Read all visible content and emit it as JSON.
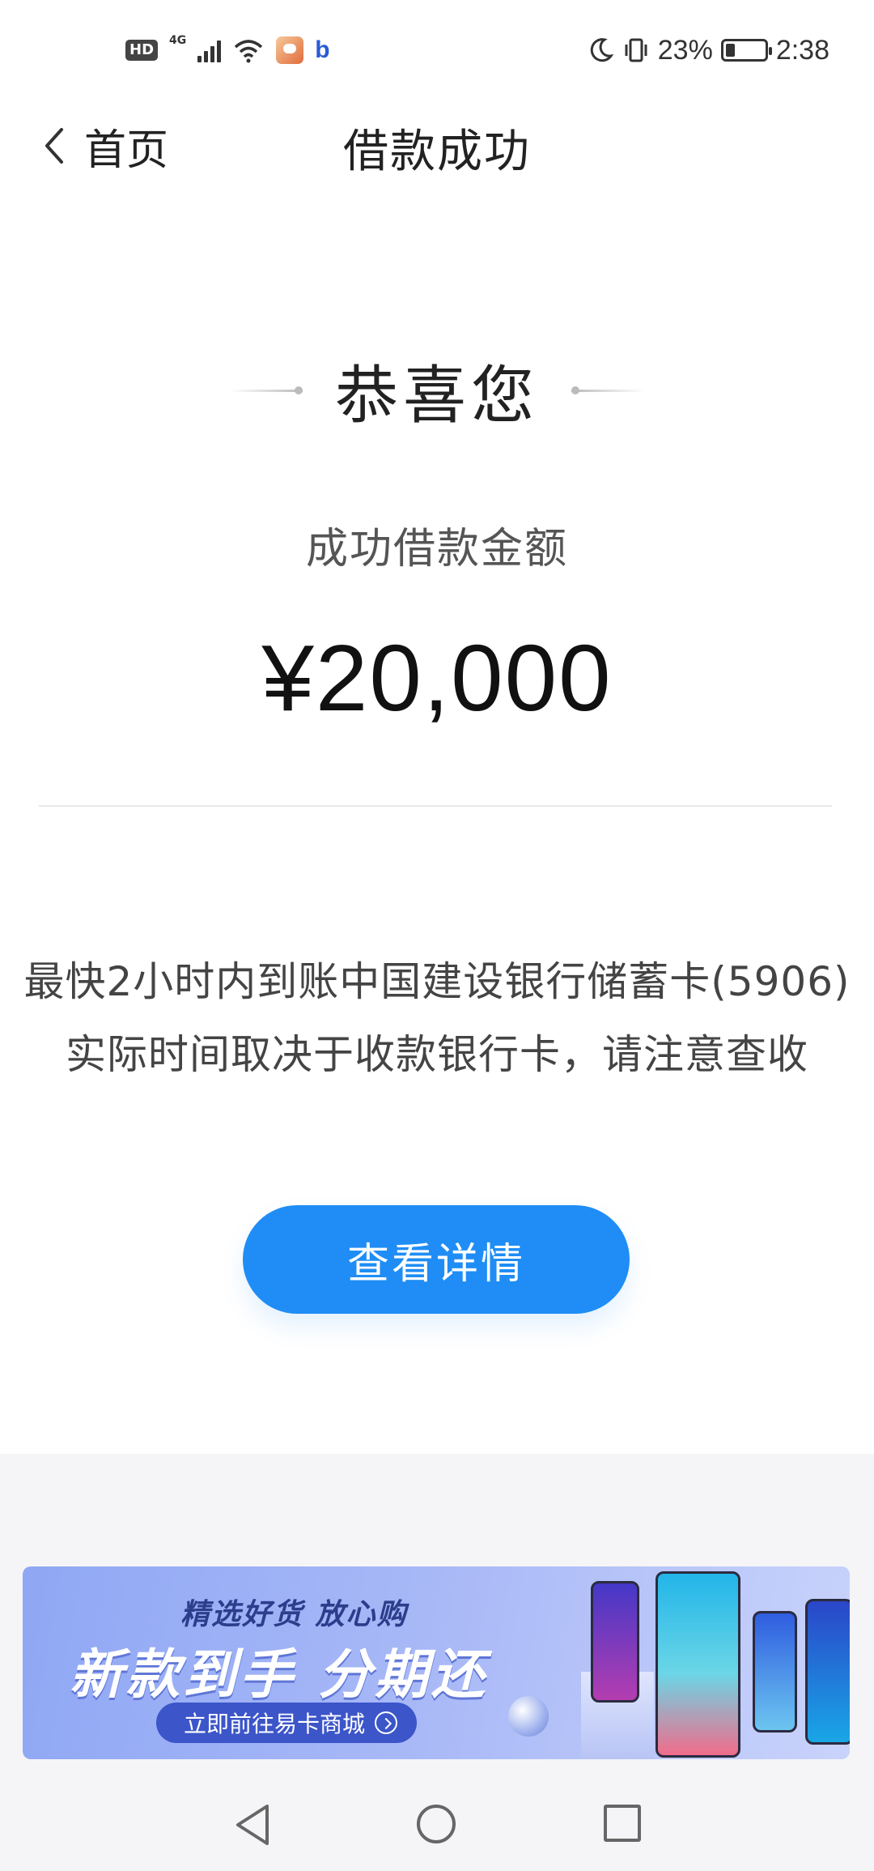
{
  "status_bar": {
    "hd": "HD",
    "network": "4G",
    "battery_percent": "23%",
    "battery_level": 0.23,
    "time": "2:38"
  },
  "nav": {
    "back_label": "首页",
    "title": "借款成功"
  },
  "result": {
    "congrats": "恭喜您",
    "amount_label": "成功借款金额",
    "amount": "¥20,000",
    "info_line1": "最快2小时内到账中国建设银行储蓄卡(5906)",
    "info_line2": "实际时间取决于收款银行卡，请注意查收",
    "detail_button": "查看详情"
  },
  "banner": {
    "tagline": "精选好货 放心购",
    "headline": "新款到手 分期还",
    "cta": "立即前往易卡商城"
  },
  "colors": {
    "accent": "#1f8df5",
    "banner_cta": "#3c55c9"
  }
}
